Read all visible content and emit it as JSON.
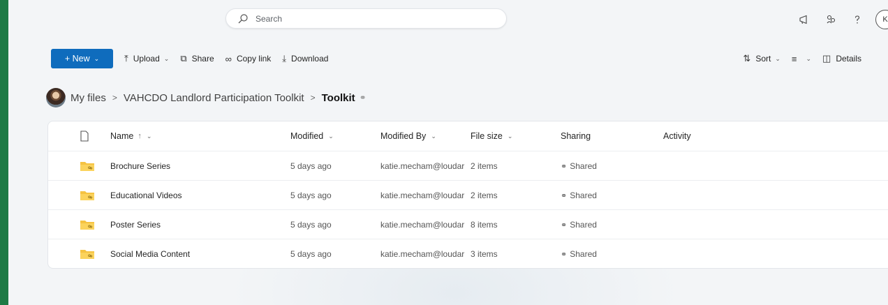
{
  "search": {
    "placeholder": "Search"
  },
  "account": {
    "initial": "K"
  },
  "toolbar": {
    "new_label": "+ New",
    "upload_label": "Upload",
    "share_label": "Share",
    "copy_link_label": "Copy link",
    "download_label": "Download",
    "sort_label": "Sort",
    "details_label": "Details"
  },
  "breadcrumb": {
    "root": "My files",
    "parent": "VAHCDO Landlord Participation Toolkit",
    "current": "Toolkit"
  },
  "table": {
    "columns": {
      "name": "Name",
      "modified": "Modified",
      "modified_by": "Modified By",
      "file_size": "File size",
      "sharing": "Sharing",
      "activity": "Activity"
    },
    "rows": [
      {
        "name": "Brochure Series",
        "modified": "5 days ago",
        "modified_by": "katie.mecham@loudar",
        "file_size": "2 items",
        "sharing": "Shared"
      },
      {
        "name": "Educational Videos",
        "modified": "5 days ago",
        "modified_by": "katie.mecham@loudar",
        "file_size": "2 items",
        "sharing": "Shared"
      },
      {
        "name": "Poster Series",
        "modified": "5 days ago",
        "modified_by": "katie.mecham@loudar",
        "file_size": "8 items",
        "sharing": "Shared"
      },
      {
        "name": "Social Media Content",
        "modified": "5 days ago",
        "modified_by": "katie.mecham@loudar",
        "file_size": "3 items",
        "sharing": "Shared"
      }
    ]
  },
  "colors": {
    "accent": "#0f6cbd",
    "frame": "#1e7a45",
    "folder": "#f5c342"
  }
}
